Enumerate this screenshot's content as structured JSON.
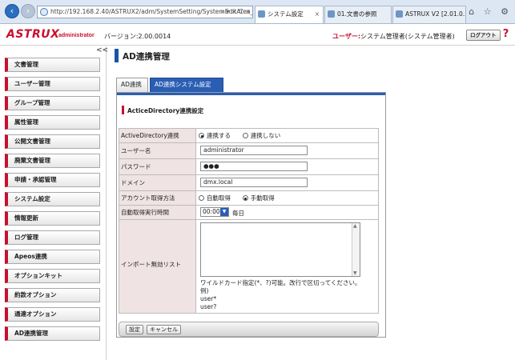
{
  "browser": {
    "url": "http://192.168.2.40/ASTRUX2/adm/SystemSetting/SystemEditArea_",
    "url_tools": "⌕ ▾ × C ×",
    "tabs": [
      {
        "label": "システム設定",
        "active": true
      },
      {
        "label": "01.文書の参照",
        "active": false
      },
      {
        "label": "ASTRUX V2 [2.01.0...",
        "active": false
      }
    ],
    "right_icons": "⌂ ☆ ⚙"
  },
  "header": {
    "logo": "ASTRUX",
    "logo_sub": "administrator",
    "version": "バージョン:2.00.0014",
    "user_label": "ユーザー:",
    "user_value": "システム管理者(システム管理者)",
    "logout": "ログアウト",
    "help": "?"
  },
  "sidebar": {
    "collapse": "<<",
    "items": [
      "文書管理",
      "ユーザー管理",
      "グループ管理",
      "属性管理",
      "公開文書管理",
      "廃棄文書管理",
      "申請・承認管理",
      "システム設定",
      "情報更新",
      "ログ管理",
      "Apeos連携",
      "オプションキット",
      "約款オプション",
      "通達オプション",
      "AD連携管理"
    ]
  },
  "main": {
    "title": "AD連携管理",
    "tabs": [
      {
        "label": "AD連携",
        "active": false
      },
      {
        "label": "AD連携システム設定",
        "active": true
      }
    ],
    "section_title": "ActiceDirectory連携設定",
    "form": {
      "ad_link": {
        "label": "ActiveDirectory連携",
        "option_on": "連携する",
        "option_off": "連携しない"
      },
      "username": {
        "label": "ユーザー名",
        "value": "administrator"
      },
      "password": {
        "label": "パスワード",
        "value": "●●●"
      },
      "domain": {
        "label": "ドメイン",
        "value": "dmx.local"
      },
      "account_method": {
        "label": "アカウント取得方法",
        "option_auto": "自動取得",
        "option_manual": "手動取得"
      },
      "auto_time": {
        "label": "自動取得実行時間",
        "value": "00:00",
        "suffix": "毎日"
      },
      "import_ignore": {
        "label": "インポート無効リスト",
        "help": "ワイルドカード指定(*、?)可能。改行で区切ってください。",
        "example_label": "例)",
        "example_1": "user*",
        "example_2": "user?"
      }
    },
    "buttons": {
      "save": "設定",
      "cancel": "キャンセル"
    }
  }
}
